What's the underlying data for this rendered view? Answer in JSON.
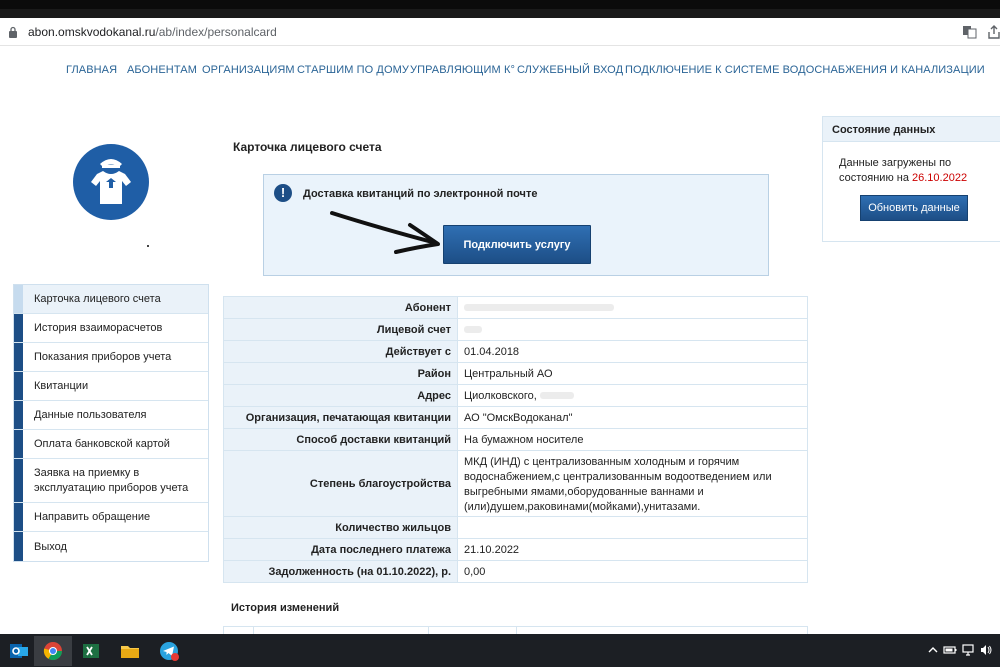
{
  "browser": {
    "url_host": "abon.omskvodokanal.ru",
    "url_path": "/ab/index/personalcard"
  },
  "nav": [
    "ГЛАВНАЯ",
    "АБОНЕНТАМ",
    "ОРГАНИЗАЦИЯМ",
    "СТАРШИМ ПО ДОМУ",
    "УПРАВЛЯЮЩИМ К°",
    "СЛУЖЕБНЫЙ ВХОД",
    "ПОДКЛЮЧЕНИЕ К СИСТЕМЕ ВОДОСНАБЖЕНИЯ И КАНАЛИЗАЦИИ"
  ],
  "sidebar": [
    "Карточка лицевого счета",
    "История взаиморасчетов",
    "Показания приборов учета",
    "Квитанции",
    "Данные пользователя",
    "Оплата банковской картой",
    "Заявка на приемку в эксплуатацию приборов учета",
    "Направить обращение",
    "Выход"
  ],
  "page_title": "Карточка лицевого счета",
  "notice": {
    "icon": "!",
    "text": "Доставка квитанций по электронной почте",
    "button": "Подключить услугу"
  },
  "details": [
    {
      "label": "Абонент",
      "value": ""
    },
    {
      "label": "Лицевой счет",
      "value": ""
    },
    {
      "label": "Действует с",
      "value": "01.04.2018"
    },
    {
      "label": "Район",
      "value": "Центральный АО"
    },
    {
      "label": "Адрес",
      "value": "Циолковского, "
    },
    {
      "label": "Организация, печатающая квитанции",
      "value": "АО \"ОмскВодоканал\""
    },
    {
      "label": "Способ доставки квитанций",
      "value": "На бумажном носителе"
    },
    {
      "label": "Степень благоустройства",
      "value": "МКД (ИНД) с централизованным холодным и горячим водоснабжением,с централизованным водоотведением или выгребными ямами,оборудованные ваннами и (или)душем,раковинами(мойками),унитазами."
    },
    {
      "label": "Количество жильцов",
      "value": ""
    },
    {
      "label": "Дата последнего платежа",
      "value": "21.10.2022"
    },
    {
      "label": "Задолженность (на 01.10.2022), р.",
      "value": "0,00"
    }
  ],
  "history_title": "История изменений",
  "status": {
    "title": "Состояние данных",
    "text": "Данные загружены по состоянию на",
    "date": "26.10.2022",
    "button": "Обновить данные"
  },
  "colors": {
    "nav_link": "#2a6496",
    "primary_button": "#1d4e86",
    "accent_date": "#cc0000",
    "panel_bg": "#eaf2f9"
  }
}
